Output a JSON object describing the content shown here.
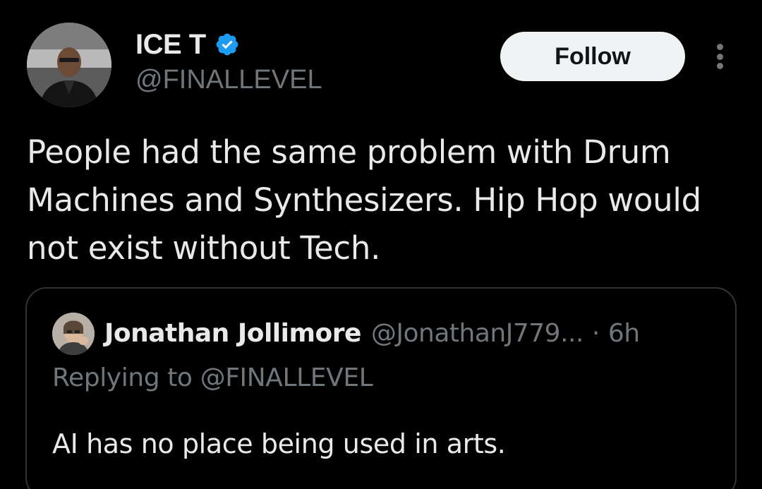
{
  "tweet": {
    "author": {
      "name": "ICE T",
      "handle": "@FINALLEVEL",
      "verified": true,
      "verified_color": "#1d9bf0"
    },
    "follow_label": "Follow",
    "more_icon": "more-vertical-icon",
    "text": "People had the same problem with Drum Machines and Synthesizers. Hip Hop would not exist without Tech.",
    "quote": {
      "name": "Jonathan Jollimore",
      "handle": "@JonathanJ779...",
      "separator": "·",
      "time": "6h",
      "replying_to": "Replying to @FINALLEVEL",
      "text": "AI has no place being used in arts."
    }
  },
  "colors": {
    "background": "#000000",
    "primary_text": "#e7e9ea",
    "secondary_text": "#71767b",
    "border": "#2f3336",
    "follow_bg": "#eff3f4",
    "follow_text": "#0f1419"
  }
}
